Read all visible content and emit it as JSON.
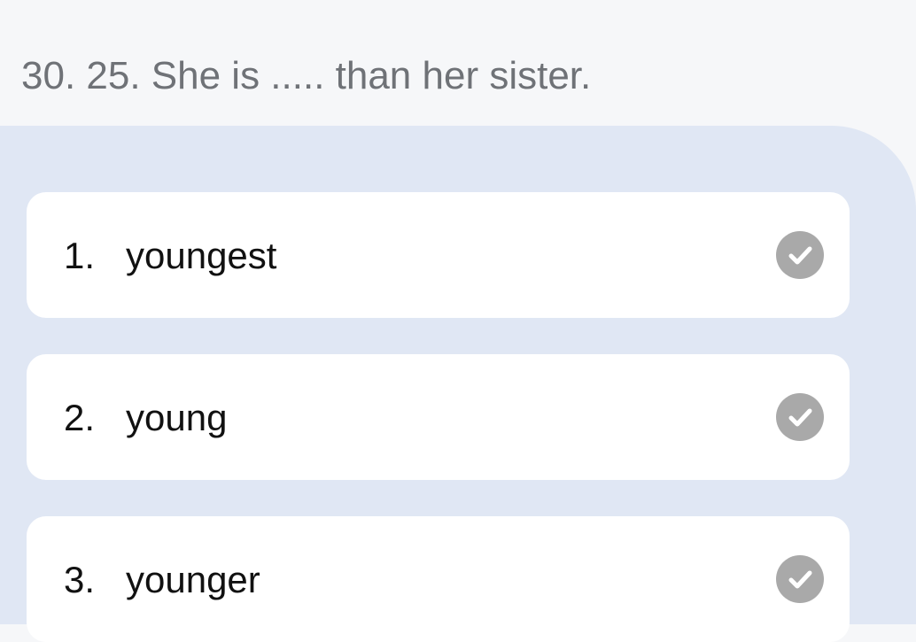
{
  "question": {
    "text": "30. 25. She is ..... than her sister."
  },
  "options": [
    {
      "number": "1.",
      "text": "youngest",
      "icon": "check-icon"
    },
    {
      "number": "2.",
      "text": "young",
      "icon": "check-icon"
    },
    {
      "number": "3.",
      "text": "younger",
      "icon": "check-icon"
    }
  ],
  "colors": {
    "background": "#f6f7f9",
    "panel": "#e0e7f4",
    "card": "#ffffff",
    "question_text": "#6f7277",
    "option_text": "#111111",
    "check_icon": "#a9a9a9"
  }
}
